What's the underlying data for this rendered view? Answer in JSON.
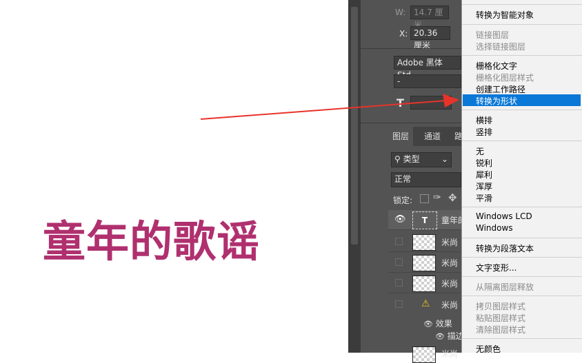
{
  "canvas": {
    "text": "童年的歌谣",
    "text_color": "#b0306f"
  },
  "properties": {
    "w_label": "W:",
    "w_value": "14.7 厘米",
    "x_label": "X:",
    "x_value": "20.36 厘米",
    "font_family": "Adobe 黑体 Std",
    "font_style": "-"
  },
  "layers_panel": {
    "tabs": [
      "图层",
      "通道",
      "路"
    ],
    "filter_label": "类型",
    "blend_mode": "正常",
    "lock_label": "锁定:",
    "layers": [
      {
        "name": "童年的",
        "type": "text"
      },
      {
        "name": "米尚",
        "type": "image"
      },
      {
        "name": "米尚",
        "type": "image"
      },
      {
        "name": "米尚",
        "type": "image"
      },
      {
        "name": "米尚",
        "type": "warning"
      }
    ],
    "effects_label": "效果",
    "effect_item": "描边",
    "last_row": "米尚"
  },
  "context_menu": {
    "accent": "#0a78d7",
    "items": [
      {
        "label": "转换为智能对象",
        "disabled": false
      },
      {
        "label": "链接图层",
        "disabled": true
      },
      {
        "label": "选择链接图层",
        "disabled": true
      },
      {
        "label": "栅格化文字",
        "disabled": false
      },
      {
        "label": "栅格化图层样式",
        "disabled": true
      },
      {
        "label": "创建工作路径",
        "disabled": false
      },
      {
        "label": "转换为形状",
        "disabled": false,
        "highlighted": true
      },
      {
        "label": "横排",
        "disabled": false
      },
      {
        "label": "竖排",
        "disabled": false
      },
      {
        "label": "无",
        "disabled": false
      },
      {
        "label": "锐利",
        "disabled": false
      },
      {
        "label": "犀利",
        "disabled": false
      },
      {
        "label": "浑厚",
        "disabled": false
      },
      {
        "label": "平滑",
        "disabled": false
      },
      {
        "label": "Windows LCD",
        "disabled": false
      },
      {
        "label": "Windows",
        "disabled": false
      },
      {
        "label": "转换为段落文本",
        "disabled": false
      },
      {
        "label": "文字变形...",
        "disabled": false
      },
      {
        "label": "从隔离图层释放",
        "disabled": true
      },
      {
        "label": "拷贝图层样式",
        "disabled": true
      },
      {
        "label": "粘贴图层样式",
        "disabled": true
      },
      {
        "label": "清除图层样式",
        "disabled": true
      },
      {
        "label": "无颜色",
        "disabled": false
      }
    ]
  },
  "annotation": {
    "arrow_color": "#e8332a"
  }
}
